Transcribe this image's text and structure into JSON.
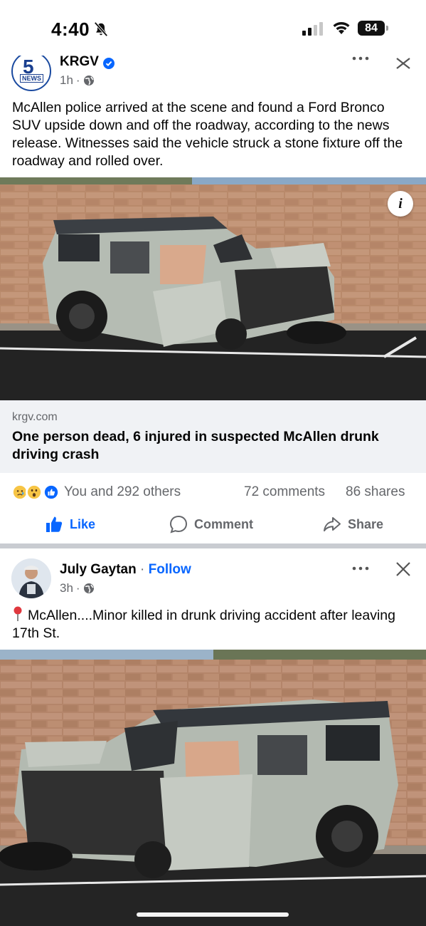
{
  "status_bar": {
    "time": "4:40",
    "battery": "84"
  },
  "post1": {
    "page_name": "KRGV",
    "avatar_number": "5",
    "avatar_sub": "NEWS",
    "time": "1h",
    "meta_sep": "·",
    "text": "McAllen police arrived at the scene and found a Ford Bronco SUV upside down and off the roadway, according to the news release. Witnesses said the vehicle struck a stone fixture off the roadway and rolled over.",
    "info_label": "i",
    "link_domain": "krgv.com",
    "link_title": "One person dead, 6 injured in suspected McAllen drunk driving crash",
    "reactions_text": "You and 292 others",
    "comments": "72 comments",
    "shares": "86 shares",
    "actions": {
      "like": "Like",
      "comment": "Comment",
      "share": "Share"
    }
  },
  "post2": {
    "user_name": "July Gaytan",
    "name_sep": "·",
    "follow": "Follow",
    "time": "3h",
    "meta_sep": "·",
    "text": "McAllen....Minor killed in drunk driving accident after leaving 17th St."
  },
  "colors": {
    "accent": "#0866ff",
    "secondary_text": "#65676b",
    "divider": "#c9ccd1",
    "link_bg": "#f0f2f5"
  }
}
